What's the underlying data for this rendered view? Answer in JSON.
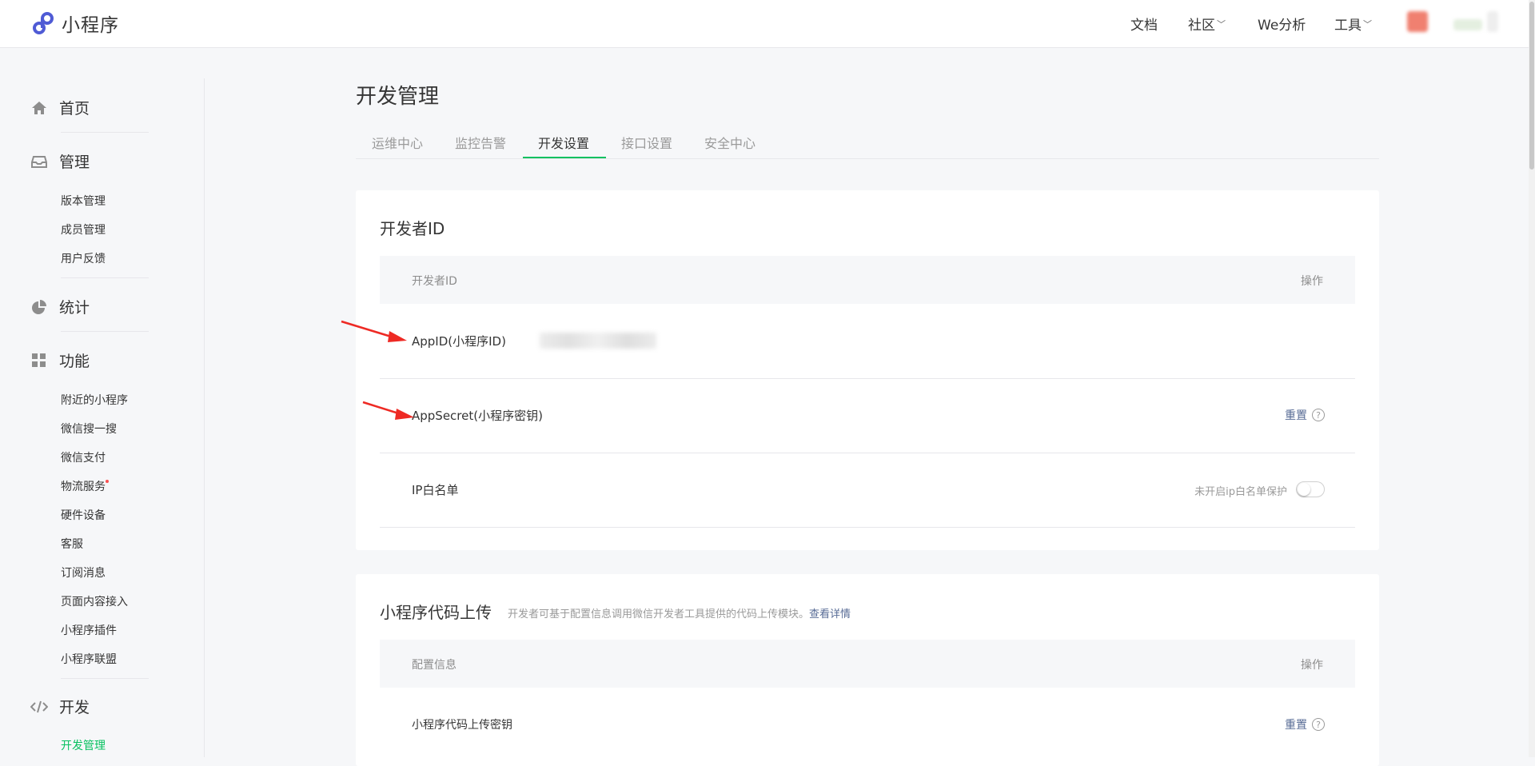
{
  "brand": {
    "name": "小程序",
    "accent": "#4F5BD5"
  },
  "topnav": {
    "docs": "文档",
    "community": "社区",
    "we_analytics": "We分析",
    "tools": "工具"
  },
  "sidebar": {
    "groups": [
      {
        "label": "首页",
        "icon": "home-icon"
      },
      {
        "label": "管理",
        "icon": "inbox-icon",
        "items": [
          "版本管理",
          "成员管理",
          "用户反馈"
        ]
      },
      {
        "label": "统计",
        "icon": "pie-chart-icon"
      },
      {
        "label": "功能",
        "icon": "grid-icon",
        "items": [
          "附近的小程序",
          "微信搜一搜",
          "微信支付",
          "物流服务",
          "硬件设备",
          "客服",
          "订阅消息",
          "页面内容接入",
          "小程序插件",
          "小程序联盟"
        ]
      },
      {
        "label": "开发",
        "icon": "code-icon",
        "items": [
          "开发管理"
        ]
      }
    ],
    "active_item": "开发管理",
    "active_color": "#07C160"
  },
  "main": {
    "title": "开发管理",
    "tabs": [
      "运维中心",
      "监控告警",
      "开发设置",
      "接口设置",
      "安全中心"
    ],
    "active_tab": "开发设置",
    "developer_id_card": {
      "title": "开发者ID",
      "columns": {
        "name": "开发者ID",
        "action": "操作"
      },
      "rows": [
        {
          "label": "AppID(小程序ID)",
          "value_hidden": true
        },
        {
          "label": "AppSecret(小程序密钥)",
          "action": "重置",
          "help": "?"
        },
        {
          "label": "IP白名单",
          "hint": "未开启ip白名单保护",
          "toggle": false
        }
      ]
    },
    "upload_card": {
      "title": "小程序代码上传",
      "desc": "开发者可基于配置信息调用微信开发者工具提供的代码上传模块。",
      "desc_link": "查看详情",
      "columns": {
        "name": "配置信息",
        "action": "操作"
      },
      "rows": [
        {
          "label": "小程序代码上传密钥",
          "action": "重置",
          "help": "?"
        }
      ]
    }
  }
}
